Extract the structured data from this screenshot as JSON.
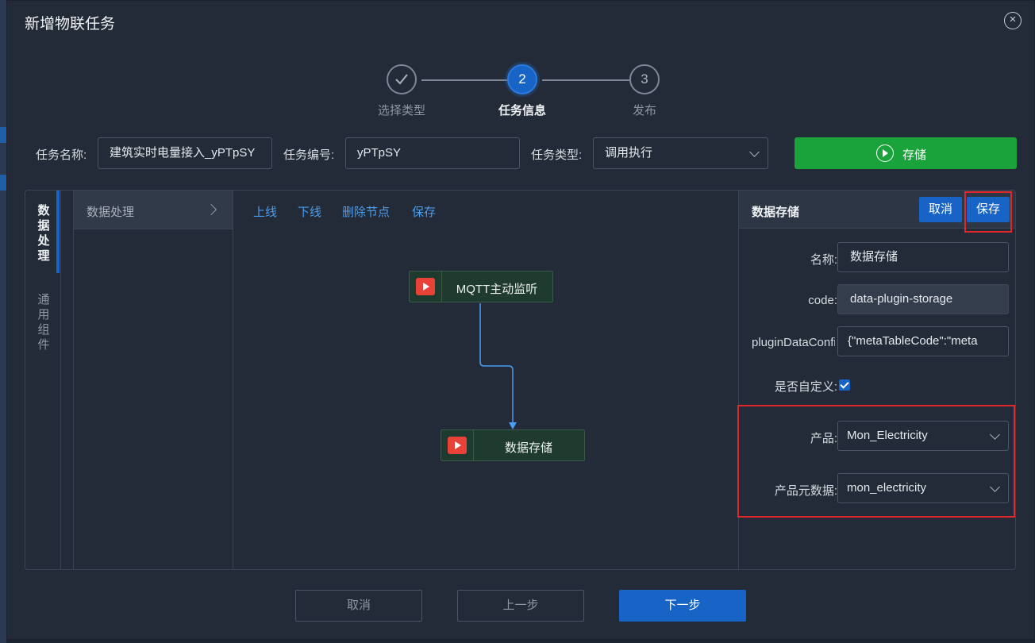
{
  "dialog": {
    "title": "新增物联任务",
    "close_glyph": "×"
  },
  "steps": [
    {
      "index": "",
      "label": "选择类型",
      "state": "done"
    },
    {
      "index": "2",
      "label": "任务信息",
      "state": "active"
    },
    {
      "index": "3",
      "label": "发布",
      "state": "todo"
    }
  ],
  "form": {
    "task_name_label": "任务名称:",
    "task_name_value": "建筑实时电量接入_yPTpSY",
    "task_code_label": "任务编号:",
    "task_code_value": "yPTpSY",
    "task_type_label": "任务类型:",
    "task_type_value": "调用执行",
    "store_button": "存储"
  },
  "vtabs": [
    {
      "label": "数据处理",
      "active": true
    },
    {
      "label": "通用组件",
      "active": false
    }
  ],
  "plugin_list": {
    "item": "数据处理"
  },
  "toolbar": {
    "online": "上线",
    "offline": "下线",
    "delete_node": "删除节点",
    "save": "保存"
  },
  "nodes": [
    {
      "label": "MQTT主动监听"
    },
    {
      "label": "数据存储"
    }
  ],
  "right_panel": {
    "title": "数据存储",
    "cancel": "取消",
    "save": "保存",
    "name_label": "名称:",
    "name_value": "数据存储",
    "code_label": "code:",
    "code_value": "data-plugin-storage",
    "plugin_label": "pluginDataConfig:",
    "plugin_value": "{\"metaTableCode\":\"meta",
    "custom_label": "是否自定义:",
    "custom_checked": true,
    "product_label": "产品:",
    "product_value": "Mon_Electricity",
    "meta_label": "产品元数据:",
    "meta_value": "mon_electricity"
  },
  "footer": {
    "cancel": "取消",
    "prev": "上一步",
    "next": "下一步"
  },
  "colors": {
    "primary": "#1764c6",
    "success": "#1aa33b",
    "highlight": "#e0282a",
    "link": "#4a9df0"
  }
}
